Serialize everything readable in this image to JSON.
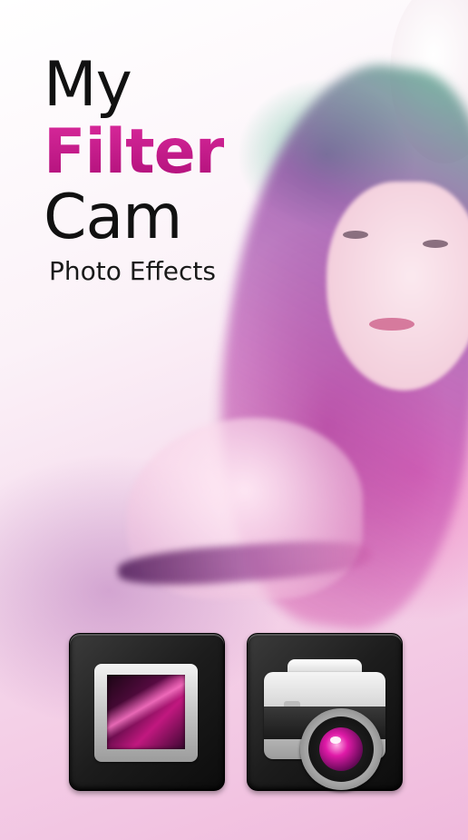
{
  "app": {
    "title_line1": "My",
    "title_line2": "Filter",
    "title_line3": "Cam",
    "subtitle": "Photo Effects"
  },
  "actions": [
    {
      "name": "gallery",
      "icon": "picture-frame-icon"
    },
    {
      "name": "camera",
      "icon": "camera-icon"
    }
  ],
  "colors": {
    "accent": "#c01a86",
    "title_text": "#111111",
    "tile_bg": "#1c1c1c"
  }
}
